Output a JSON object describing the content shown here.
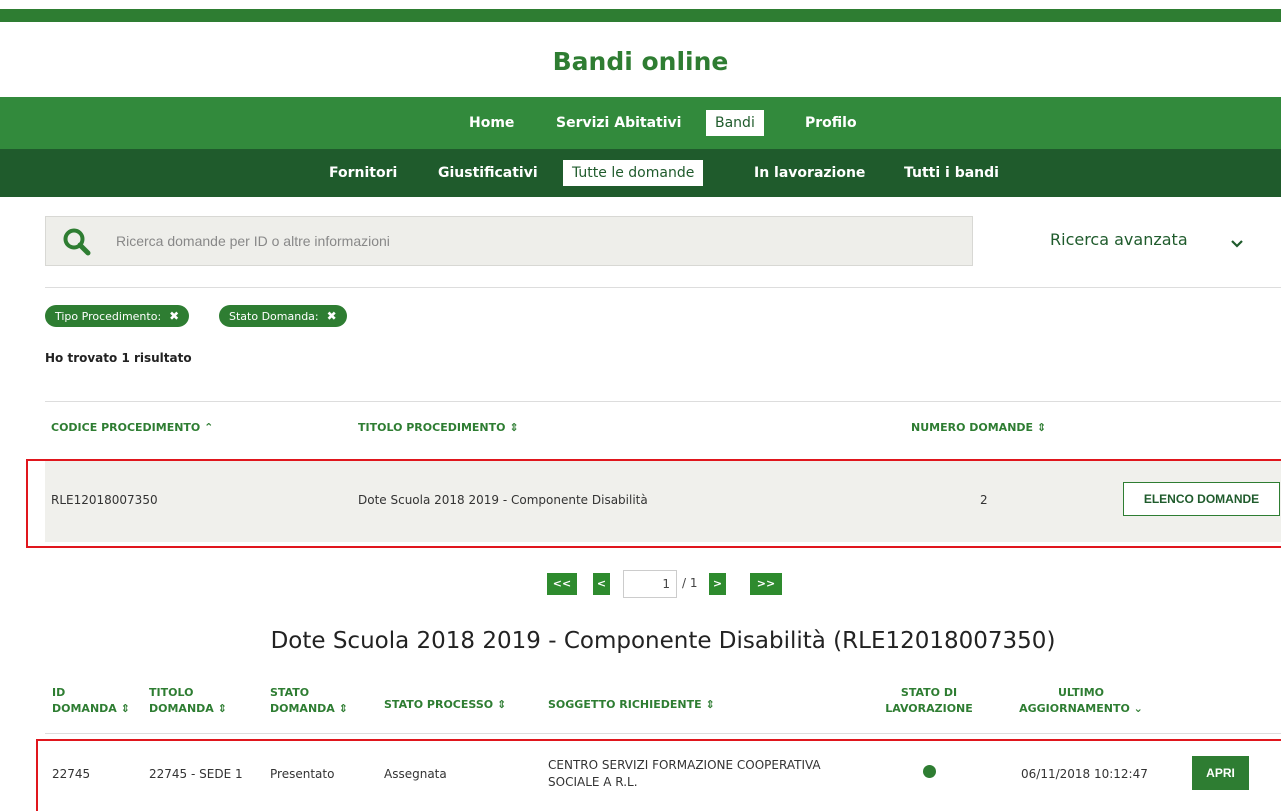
{
  "header": {
    "title": "Bandi online"
  },
  "nav_main": [
    "Home",
    "Servizi Abitativi",
    "Bandi",
    "Profilo"
  ],
  "nav_sub": [
    "Fornitori",
    "Giustificativi",
    "Tutte le domande",
    "In lavorazione",
    "Tutti i bandi"
  ],
  "search": {
    "placeholder": "Ricerca domande per ID o altre informazioni",
    "advanced_label": "Ricerca avanzata"
  },
  "filters": [
    "Tipo Procedimento:",
    "Stato Domanda:"
  ],
  "results_text": "Ho trovato 1 risultato",
  "table1": {
    "headers": [
      "CODICE PROCEDIMENTO",
      "TITOLO PROCEDIMENTO",
      "NUMERO DOMANDE"
    ],
    "row": {
      "codice": "RLE12018007350",
      "titolo": "Dote Scuola 2018 2019 - Componente Disabilità",
      "numero": "2",
      "button": "ELENCO DOMANDE"
    }
  },
  "pagination": {
    "first": "<<",
    "prev": "<",
    "page": "1",
    "total": "/ 1",
    "next": ">",
    "last": ">>"
  },
  "section_title": "Dote Scuola 2018 2019 - Componente Disabilità (RLE12018007350)",
  "table2": {
    "headers": {
      "id_1": "ID",
      "id_2": "DOMANDA",
      "titolo_1": "TITOLO",
      "titolo_2": "DOMANDA",
      "stato_1": "STATO",
      "stato_2": "DOMANDA",
      "processo": "STATO PROCESSO",
      "soggetto": "SOGGETTO RICHIEDENTE",
      "lav_1": "STATO DI",
      "lav_2": "LAVORAZIONE",
      "agg_1": "ULTIMO",
      "agg_2": "AGGIORNAMENTO"
    },
    "row": {
      "id": "22745",
      "titolo": "22745 - SEDE 1",
      "stato": "Presentato",
      "processo": "Assegnata",
      "soggetto_1": "CENTRO SERVIZI FORMAZIONE COOPERATIVA",
      "soggetto_2": "SOCIALE A R.L.",
      "aggiornamento": "06/11/2018 10:12:47",
      "button": "APRI"
    }
  },
  "colors": {
    "brand_green": "#2e7d32",
    "nav_green": "#328a3c",
    "subnav_green": "#1f5b2c",
    "highlight_red": "#e0161d"
  }
}
